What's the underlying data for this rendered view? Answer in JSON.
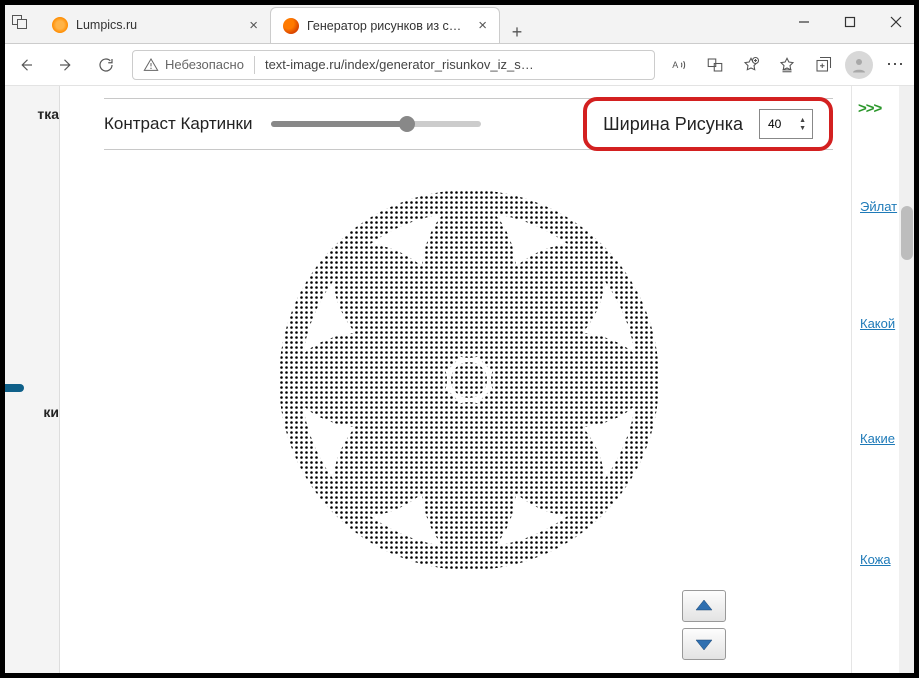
{
  "tabs": [
    {
      "label": "Lumpics.ru",
      "active": false
    },
    {
      "label": "Генератор рисунков из символ",
      "active": true
    }
  ],
  "toolbar": {
    "security_label": "Небезопасно",
    "url": "text-image.ru/index/generator_risunkov_iz_s…"
  },
  "left_sidebar": {
    "item1": "тка",
    "item2": "ки"
  },
  "controls": {
    "contrast_label": "Контраст Картинки",
    "width_label": "Ширина Рисунка",
    "width_value": "40"
  },
  "right_sidebar": {
    "arrows": ">>>",
    "link1": "Эйлат",
    "link2": "Какой",
    "link3": "Какие",
    "link4": "Кожа"
  }
}
